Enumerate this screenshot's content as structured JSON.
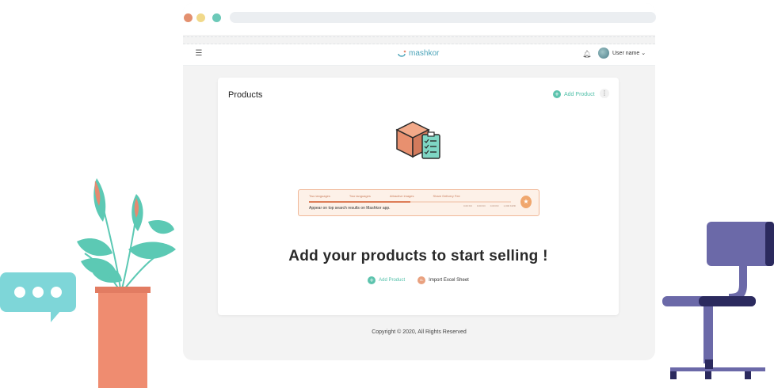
{
  "browser": {
    "url": ""
  },
  "app": {
    "brand": "mashkor",
    "username": "User name",
    "menu_icon": "menu-icon",
    "bell_icon": "bell-icon"
  },
  "products": {
    "title": "Products",
    "header_add_label": "Add Product",
    "more_icon": "more-vertical-icon"
  },
  "promo_strip": {
    "labels": [
      "Two languages",
      "Two languages",
      "Attractive images",
      "Share Delivery Fee"
    ],
    "progress": 0.5,
    "text": "Appear on top search results on Mashkor app.",
    "stats": [
      "0.00 KD",
      "0.00 KD",
      "0.00 KD",
      "1,000 KWD"
    ],
    "badge_icon": "trophy-icon"
  },
  "empty_state": {
    "headline": "Add your products to start selling !",
    "add_label": "Add Product",
    "import_label": "Import Excel Sheet",
    "import_badge": "XL"
  },
  "footer": {
    "copyright": "Copyright © 2020, All Rights Reserved"
  },
  "colors": {
    "accent": "#5cc3ad",
    "orange": "#e9a17f",
    "chair": "#6b69a8"
  }
}
